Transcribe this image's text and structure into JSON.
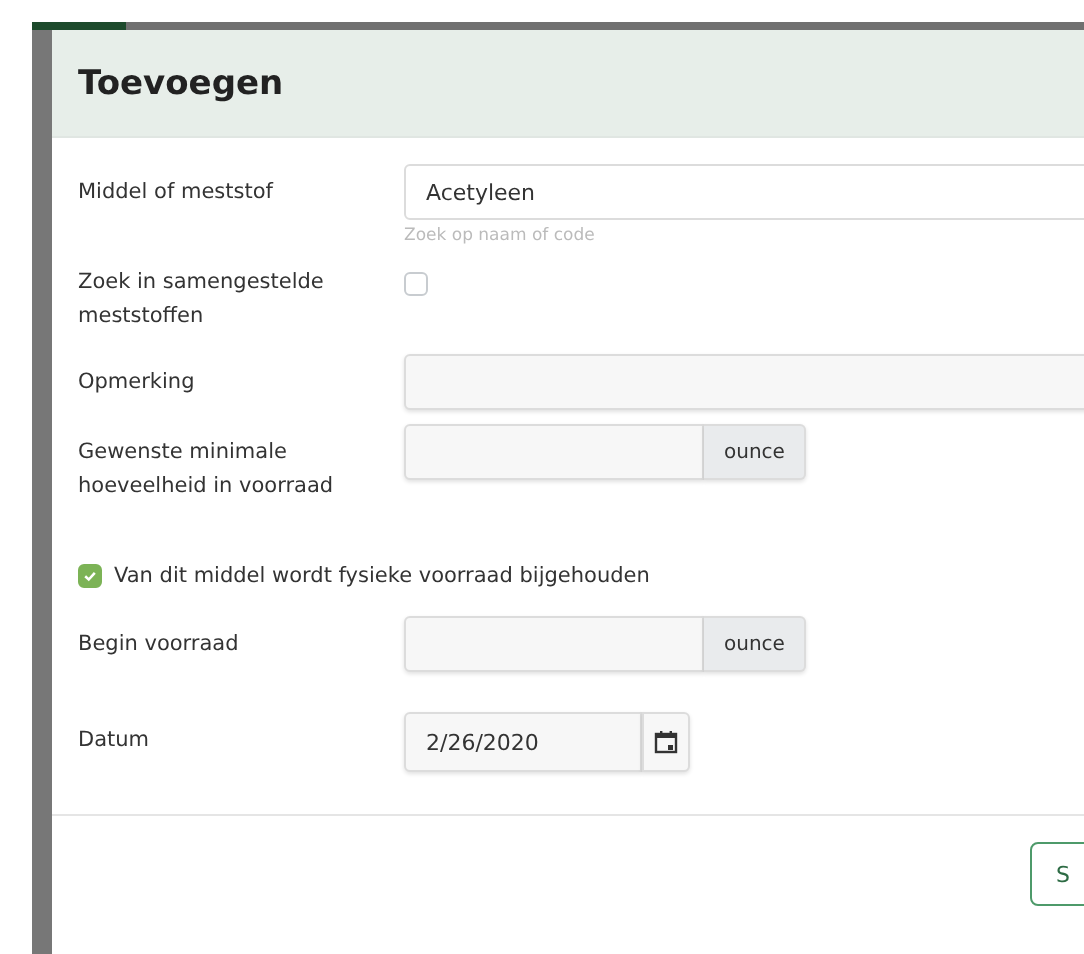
{
  "dialog": {
    "title": "Toevoegen"
  },
  "fields": [
    {
      "kind": "text",
      "label": "Middel of meststof",
      "value": "Acetyleen",
      "hint": "Zoek op naam of code"
    },
    {
      "kind": "checkbox",
      "label": "Zoek in samengestelde meststoffen",
      "checked": false
    },
    {
      "kind": "text",
      "label": "Opmerking"
    },
    {
      "kind": "unit",
      "label": "Gewenste minimale hoeveelheid in voorraad",
      "unit": "ounce"
    },
    {
      "kind": "inline-checkbox",
      "label": "Van dit middel wordt fysieke voorraad bijgehouden",
      "checked": true
    },
    {
      "kind": "unit",
      "label": "Begin voorraad",
      "unit": "ounce"
    },
    {
      "kind": "date",
      "label": "Datum",
      "value": "2/26/2020"
    }
  ],
  "footer": {
    "buttons": [
      "S"
    ]
  }
}
